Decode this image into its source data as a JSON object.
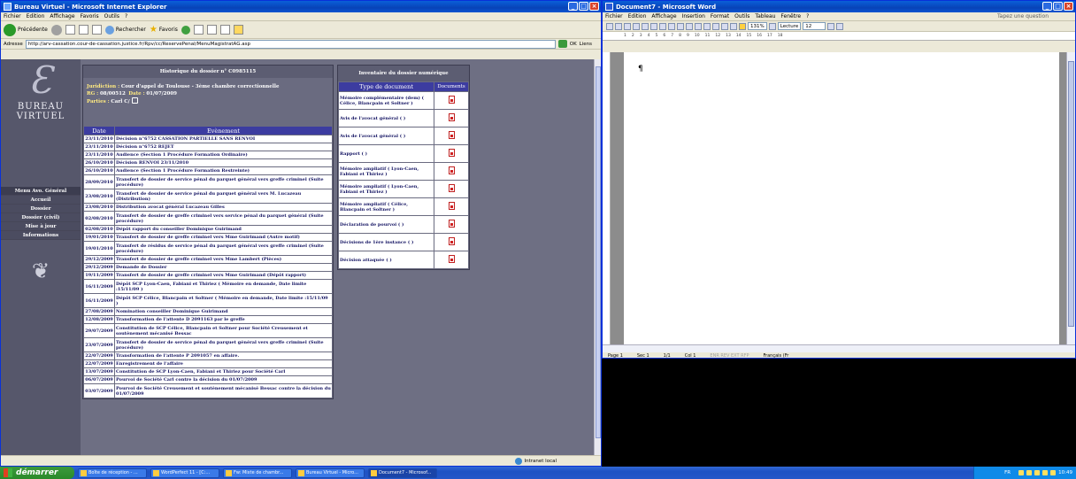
{
  "ie": {
    "title": "Bureau Virtuel - Microsoft Internet Explorer",
    "menu": [
      "Fichier",
      "Edition",
      "Affichage",
      "Favoris",
      "Outils",
      "?"
    ],
    "toolbar": {
      "back": "Précédente",
      "search": "Rechercher",
      "favorites": "Favoris"
    },
    "address_label": "Adresse",
    "address": "http://arv-cassation.cour-de-cassation.justice.fr/Rpv/cc/ReservePenal/MenuMagistratAG.asp",
    "go": "OK",
    "links": "Liens",
    "status": "Intranet local"
  },
  "bv": {
    "logo_line1": "BUREAU",
    "logo_line2": "VIRTUEL",
    "menu": [
      "Menu Avo. Général",
      "Accueil",
      "Dossier",
      "Dossier (civil)",
      "Mise à jour",
      "Informations"
    ]
  },
  "history": {
    "title": "Historique du dossier n° C0985115",
    "juridiction_label": "Juridiction :",
    "juridiction": "Cour d'appel de Toulouse - 3ème chambre correctionnelle",
    "rg_label": "RG :",
    "rg": "08/00512",
    "date_label": "Date :",
    "date": "01/07/2009",
    "parties_label": "Parties :",
    "parties": "Carl C/",
    "col_date": "Date",
    "col_event": "Evènement",
    "rows": [
      {
        "date": "23/11/2010",
        "event": "Décision n°6752 CASSATION PARTIELLE SANS RENVOI"
      },
      {
        "date": "23/11/2010",
        "event": "Décision n°6752 REJET"
      },
      {
        "date": "23/11/2010",
        "event": "Audience (Section 1 Procédure Formation Ordinaire)"
      },
      {
        "date": "26/10/2010",
        "event": "Décision RENVOI 23/11/2010"
      },
      {
        "date": "26/10/2010",
        "event": "Audience (Section 1 Procédure Formation Restreinte)"
      },
      {
        "date": "28/09/2010",
        "event": "Transfert de dossier de service pénal du parquet général vers greffe criminel (Suite procédure)"
      },
      {
        "date": "23/08/2010",
        "event": "Transfert de dossier de service pénal du parquet général vers M. Lucazeau (Distribution)"
      },
      {
        "date": "23/08/2010",
        "event": "Distribution avocat général Lucazeau Gilles"
      },
      {
        "date": "02/08/2010",
        "event": "Transfert de dossier de greffe criminel vers service pénal du parquet général (Suite procédure)"
      },
      {
        "date": "02/08/2010",
        "event": "Dépôt rapport du conseiller Dominique Guirimand"
      },
      {
        "date": "19/01/2010",
        "event": "Transfert de dossier de greffe criminel vers Mme Guirimand (Autre motif)"
      },
      {
        "date": "19/01/2010",
        "event": "Transfert de résidus de service pénal du parquet général vers greffe criminel (Suite procédure)"
      },
      {
        "date": "29/12/2009",
        "event": "Transfert de dossier de greffe criminel vers Mme Lambert (Pièces)"
      },
      {
        "date": "29/12/2009",
        "event": "Demande de Dossier"
      },
      {
        "date": "19/11/2009",
        "event": "Transfert de dossier de greffe criminel vers Mme Guirimand (Dépôt rapport)"
      },
      {
        "date": "16/11/2009",
        "event": "Dépôt SCP Lyon-Caen, Fabiani et Thiriez ( Mémoire en demande, Date limite :15/11/09 )"
      },
      {
        "date": "16/11/2009",
        "event": "Dépôt SCP Célice, Blancpain et Soltner ( Mémoire en demande, Date limite :15/11/09 )"
      },
      {
        "date": "27/08/2009",
        "event": "Nomination conseiller Dominique Guirimand"
      },
      {
        "date": "12/08/2009",
        "event": "Transformation de l'attente D 2091163 par le greffe"
      },
      {
        "date": "29/07/2009",
        "event": "Constitution de SCP Célice, Blancpain et Soltner pour Société Creusement et soutènement mécanisé Bessac"
      },
      {
        "date": "23/07/2009",
        "event": "Transfert de dossier de service pénal du parquet général vers greffe criminel (Suite procédure)"
      },
      {
        "date": "22/07/2009",
        "event": "Transformation de l'attente P 2091057 en affaire."
      },
      {
        "date": "22/07/2009",
        "event": "Enregistrement de l'affaire"
      },
      {
        "date": "13/07/2009",
        "event": "Constitution de SCP Lyon-Caen, Fabiani et Thiriez pour Société Carl"
      },
      {
        "date": "06/07/2009",
        "event": "Pourvoi de Société Carl contre la décision du 01/07/2009"
      },
      {
        "date": "03/07/2009",
        "event": "Pourvoi de Société Creusement et soutènement mécanisé Bessac contre la décision du 01/07/2009"
      }
    ]
  },
  "inventory": {
    "title": "Inventaire du dossier numérique",
    "col_type": "Type de document",
    "col_docs": "Documents",
    "rows": [
      "Mémoire complémentaire (dem) ( Célice, Blancpain et Soltner )",
      "Avis de l'avocat général ( )",
      "Avis de l'avocat général ( )",
      "Rapport ( )",
      "Mémoire ampliatif ( Lyon-Caen, Fabiani et Thiriez )",
      "Mémoire ampliatif ( Lyon-Caen, Fabiani et Thiriez )",
      "Mémoire ampliatif ( Célice, Blancpain et Soltner )",
      "Déclaration de pourvoi ( )",
      "Décisions de 1ère instance ( )",
      "Décision attaquée ( )"
    ]
  },
  "word": {
    "title": "Document7 - Microsoft Word",
    "menu": [
      "Fichier",
      "Edition",
      "Affichage",
      "Insertion",
      "Format",
      "Outils",
      "Tableau",
      "Fenêtre",
      "?"
    ],
    "help_box": "Tapez une question",
    "zoom": "131%",
    "lecture": "Lecture",
    "font_size": "12",
    "status": {
      "page": "Page 1",
      "sec": "Sec 1",
      "pages": "1/1",
      "col": "Col 1",
      "modes": "ENR  REV  EXT  RFP",
      "lang": "Français (Fr"
    }
  },
  "taskbar": {
    "start": "démarrer",
    "tasks": [
      "Boîte de réception - ...",
      "WordPerfect 11 - [C:...",
      "Fw: Mixte de chambr...",
      "Bureau Virtuel - Micro...",
      "Document7 - Microsof..."
    ],
    "lang": "FR",
    "clock": "10:49"
  }
}
